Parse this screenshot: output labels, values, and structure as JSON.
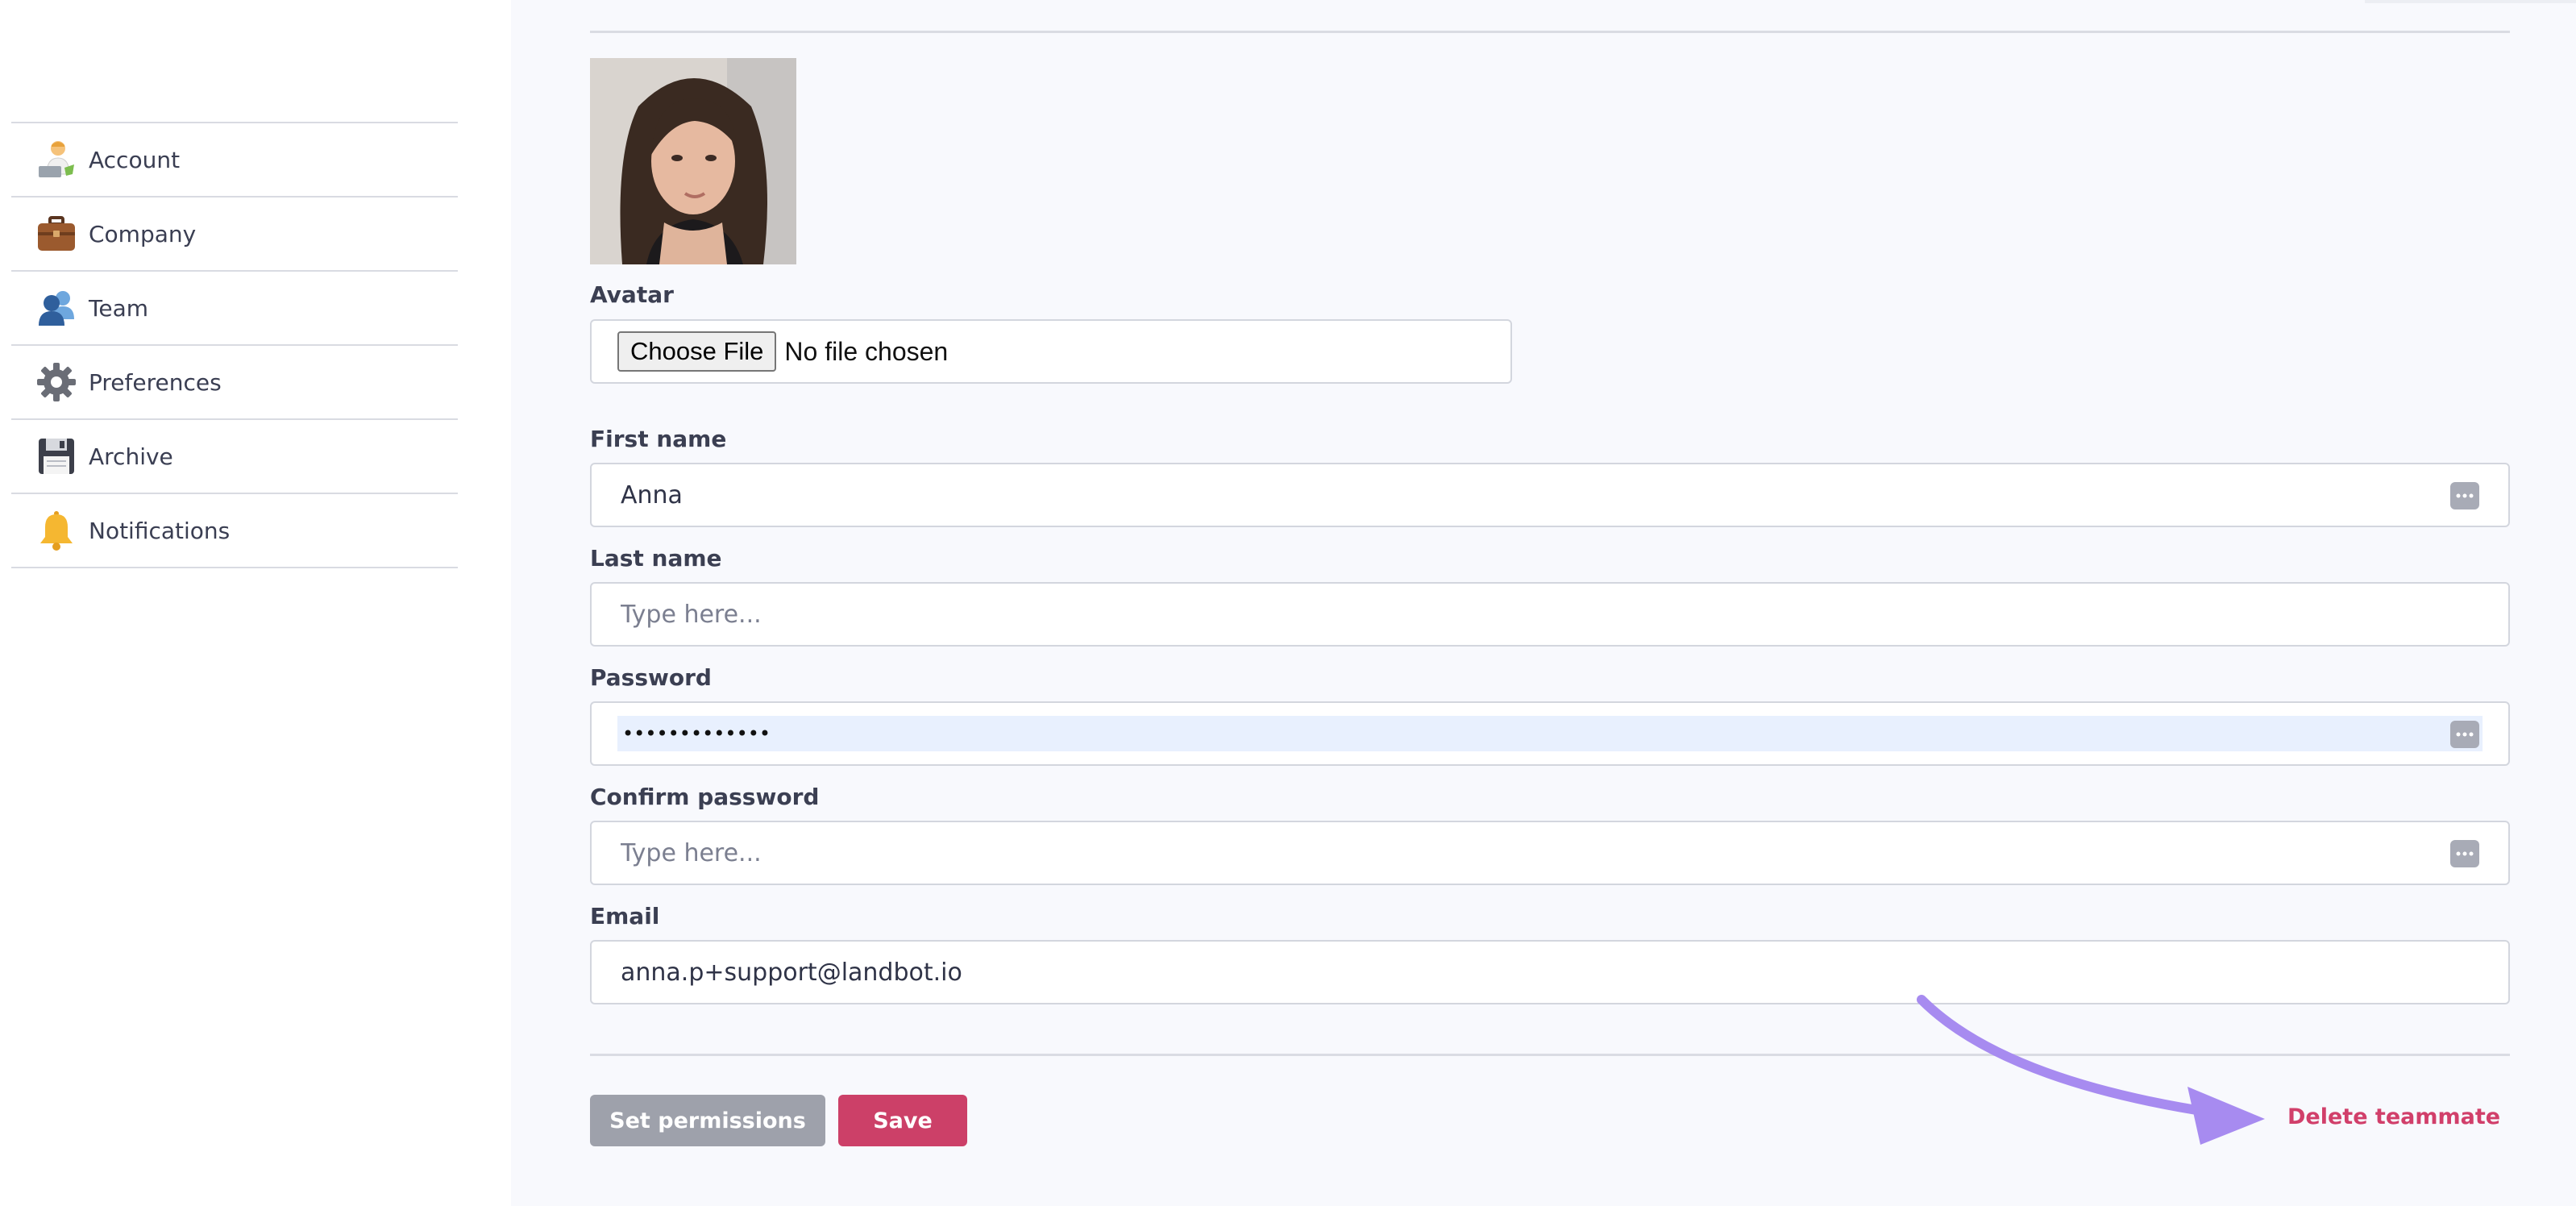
{
  "sidebar": {
    "items": [
      {
        "label": "Account",
        "icon": "account-icon"
      },
      {
        "label": "Company",
        "icon": "briefcase-icon"
      },
      {
        "label": "Team",
        "icon": "team-icon"
      },
      {
        "label": "Preferences",
        "icon": "gear-icon"
      },
      {
        "label": "Archive",
        "icon": "floppy-disk-icon"
      },
      {
        "label": "Notifications",
        "icon": "bell-icon"
      }
    ]
  },
  "form": {
    "avatar": {
      "label": "Avatar",
      "choose_file_label": "Choose File",
      "file_status": "No file chosen"
    },
    "first_name": {
      "label": "First name",
      "value": "Anna"
    },
    "last_name": {
      "label": "Last name",
      "value": "",
      "placeholder": "Type here..."
    },
    "password": {
      "label": "Password",
      "masked_value": "•••••••••••••"
    },
    "confirm_password": {
      "label": "Confirm password",
      "value": "",
      "placeholder": "Type here..."
    },
    "email": {
      "label": "Email",
      "value": "anna.p+support@landbot.io"
    }
  },
  "actions": {
    "set_permissions_label": "Set permissions",
    "save_label": "Save",
    "delete_label": "Delete teammate"
  },
  "colors": {
    "accent": "#cc4068",
    "delete": "#d13f6a",
    "arrow": "#a78bf0",
    "muted_button": "#9ea1ab"
  }
}
